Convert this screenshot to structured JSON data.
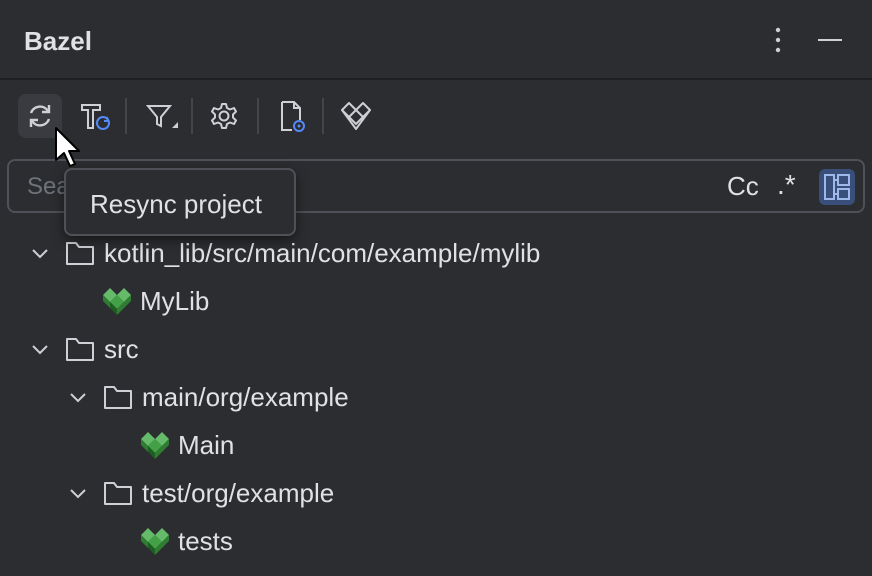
{
  "panel": {
    "title": "Bazel"
  },
  "header": {
    "more_icon": "more-vertical-icon",
    "minimize_icon": "minimize-icon"
  },
  "toolbar": {
    "buttons": [
      {
        "icon": "resync-icon",
        "active": true
      },
      {
        "icon": "build-resync-icon"
      },
      {
        "icon": "filter-icon"
      },
      {
        "icon": "settings-icon"
      },
      {
        "icon": "project-view-icon"
      },
      {
        "icon": "bazel-logo-icon"
      }
    ]
  },
  "search": {
    "placeholder": "Search",
    "case_label": "Cc",
    "regex_label": ".*"
  },
  "tooltip": {
    "text": "Resync project"
  },
  "tree": {
    "items": [
      {
        "label": "kotlin_lib/src/main/com/example/mylib",
        "type": "folder",
        "expanded": true
      },
      {
        "label": "MyLib",
        "type": "target"
      },
      {
        "label": "src",
        "type": "folder",
        "expanded": true
      },
      {
        "label": "main/org/example",
        "type": "folder",
        "expanded": true
      },
      {
        "label": "Main",
        "type": "target"
      },
      {
        "label": "test/org/example",
        "type": "folder",
        "expanded": true
      },
      {
        "label": "tests",
        "type": "target"
      }
    ]
  },
  "colors": {
    "background": "#2b2d30",
    "accent": "#548af7",
    "bazel_green": "#43a047"
  }
}
